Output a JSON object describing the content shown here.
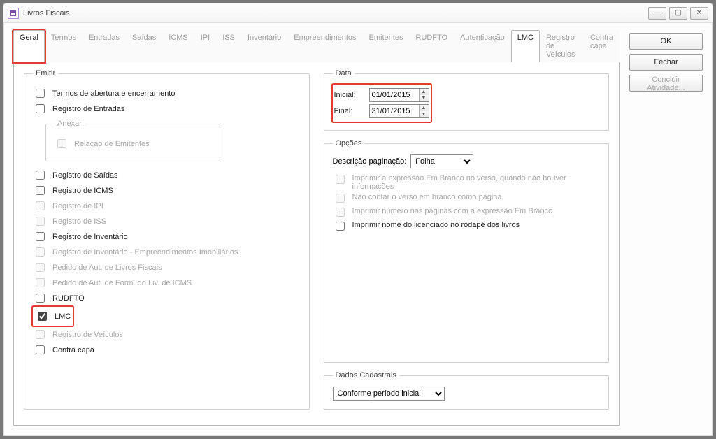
{
  "window": {
    "title": "Livros Fiscais"
  },
  "tabs": {
    "items": [
      {
        "label": "Geral",
        "active": true,
        "highlight": true
      },
      {
        "label": "Termos"
      },
      {
        "label": "Entradas"
      },
      {
        "label": "Saídas"
      },
      {
        "label": "ICMS"
      },
      {
        "label": "IPI"
      },
      {
        "label": "ISS"
      },
      {
        "label": "Inventário"
      },
      {
        "label": "Empreendimentos"
      },
      {
        "label": "Emitentes"
      },
      {
        "label": "RUDFTO"
      },
      {
        "label": "Autenticação"
      },
      {
        "label": "LMC",
        "active": true
      },
      {
        "label": "Registro de Veículos"
      },
      {
        "label": "Contra capa"
      }
    ]
  },
  "emitir": {
    "legend": "Emitir",
    "items": [
      {
        "label": "Termos de abertura e encerramento",
        "enabled": true,
        "checked": false
      },
      {
        "label": "Registro de Entradas",
        "enabled": true,
        "checked": false
      }
    ],
    "anexar": {
      "legend": "Anexar",
      "item": {
        "label": "Relação de Emitentes",
        "enabled": false,
        "checked": false
      }
    },
    "rest": [
      {
        "label": "Registro de Saídas",
        "enabled": true,
        "checked": false
      },
      {
        "label": "Registro de ICMS",
        "enabled": true,
        "checked": false
      },
      {
        "label": "Registro de IPI",
        "enabled": false,
        "checked": false
      },
      {
        "label": "Registro de ISS",
        "enabled": false,
        "checked": false
      },
      {
        "label": "Registro de Inventário",
        "enabled": true,
        "checked": false
      },
      {
        "label": "Registro de Inventário - Empreendimentos Imobiliários",
        "enabled": false,
        "checked": false
      },
      {
        "label": "Pedido de Aut. de Livros Fiscais",
        "enabled": false,
        "checked": false
      },
      {
        "label": "Pedido de Aut. de Form. do Liv. de ICMS",
        "enabled": false,
        "checked": false
      },
      {
        "label": "RUDFTO",
        "enabled": true,
        "checked": false
      },
      {
        "label": "LMC",
        "enabled": true,
        "checked": true,
        "highlight": true
      },
      {
        "label": "Registro de Veículos",
        "enabled": false,
        "checked": false
      },
      {
        "label": "Contra capa",
        "enabled": true,
        "checked": false
      }
    ]
  },
  "data": {
    "legend": "Data",
    "inicial": {
      "label": "Inicial:",
      "value": "01/01/2015"
    },
    "final": {
      "label": "Final:",
      "value": "31/01/2015"
    }
  },
  "opcoes": {
    "legend": "Opções",
    "paginacao": {
      "label": "Descrição paginação:",
      "value": "Folha"
    },
    "items": [
      {
        "label": "Imprimir a expressão Em Branco no verso, quando não houver informações",
        "enabled": false
      },
      {
        "label": "Não contar o verso em branco como página",
        "enabled": false
      },
      {
        "label": "Imprimir número nas páginas com a expressão Em Branco",
        "enabled": false
      },
      {
        "label": "Imprimir nome do licenciado no rodapé dos livros",
        "enabled": true
      }
    ]
  },
  "dados": {
    "legend": "Dados Cadastrais",
    "value": "Conforme período inicial"
  },
  "buttons": {
    "ok": "OK",
    "fechar": "Fechar",
    "concluir": "Concluir Atividade..."
  }
}
